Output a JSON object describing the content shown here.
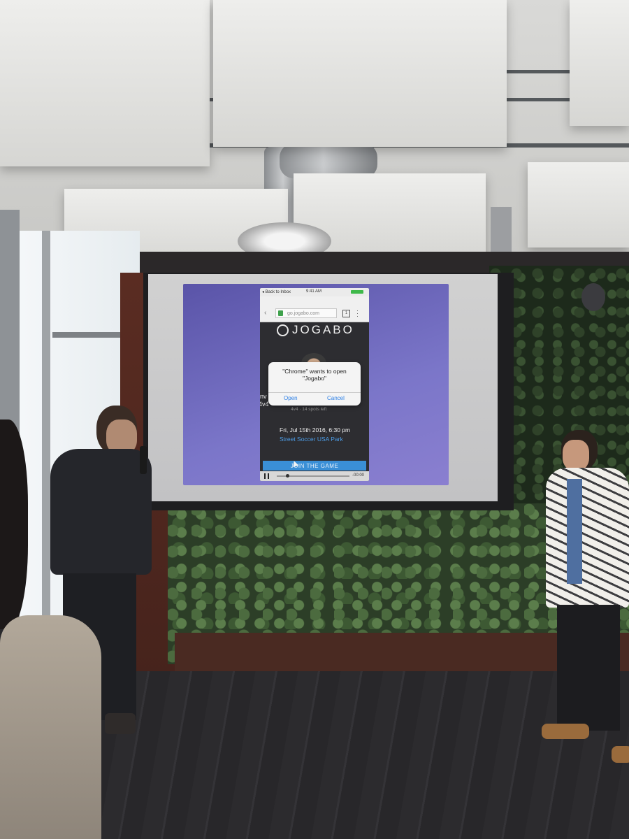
{
  "photo": {
    "colors": {
      "slide_purple": "#7b76c9",
      "phone_bg": "#2d2d31",
      "link_blue": "#4d9ee8",
      "join_button_blue": "#3a8fd6"
    }
  },
  "phone_screen": {
    "status": {
      "back_to": "◂ Back to Inbox",
      "time": "9:41 AM"
    },
    "browser": {
      "url": "go.jogabo.com",
      "tab_count": "1",
      "icons": [
        "lock-icon",
        "tabs-icon",
        "menu-icon",
        "back-arrow-icon"
      ]
    },
    "app": {
      "logo_text": "JOGABO",
      "left_text_1": "inv",
      "left_text_2": "4v4",
      "spots": "4v4 · 14 spots left",
      "date": "Fri, Jul 15th 2016, 6:30 pm",
      "venue": "Street Soccer USA Park",
      "join_label": "JOIN THE GAME"
    },
    "dialog": {
      "title_line1": "\"Chrome\" wants to open",
      "title_line2": "\"Jogabo\"",
      "open_label": "Open",
      "cancel_label": "Cancel"
    },
    "video_controls": {
      "time_remaining": "-00:00",
      "progress": 0.15
    }
  }
}
